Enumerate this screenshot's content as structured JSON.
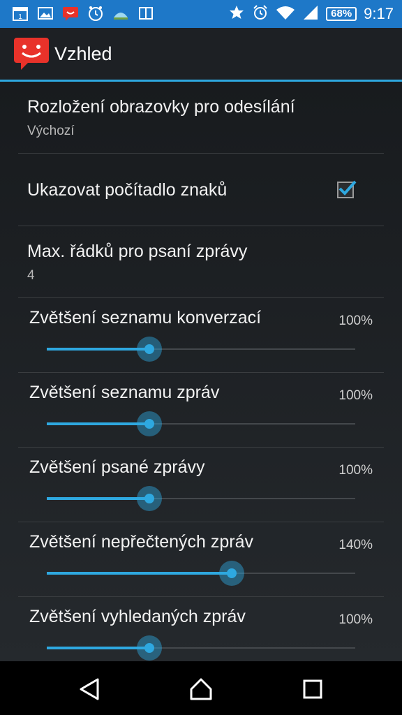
{
  "status_bar": {
    "battery_level": "68%",
    "time": "9:17",
    "icons": [
      "calendar-icon",
      "gallery-icon",
      "sms-notification-icon",
      "alarm-app-icon",
      "weather-icon",
      "book-icon",
      "star-icon",
      "alarm-clock-icon",
      "wifi-icon",
      "signal-icon",
      "battery-icon"
    ]
  },
  "action_bar": {
    "title": "Vzhled",
    "app_icon": "smiley-message-icon"
  },
  "preferences": [
    {
      "title": "Rozložení obrazovky pro odesílání",
      "summary": "Výchozí"
    },
    {
      "title": "Ukazovat počítadlo znaků",
      "checked": true
    },
    {
      "title": "Max. řádků pro psaní zprávy",
      "summary": "4"
    }
  ],
  "sliders": [
    {
      "title": "Zvětšení seznamu konverzací",
      "value": "100%",
      "level": 0.333
    },
    {
      "title": "Zvětšení seznamu zpráv",
      "value": "100%",
      "level": 0.333
    },
    {
      "title": "Zvětšení psané zprávy",
      "value": "100%",
      "level": 0.333
    },
    {
      "title": "Zvětšení nepřečtených zpráv",
      "value": "140%",
      "level": 0.6
    },
    {
      "title": "Zvětšení vyhledaných zpráv",
      "value": "100%",
      "level": 0.333
    }
  ],
  "nav_bar": {
    "buttons": [
      "back-icon",
      "home-icon",
      "recents-icon"
    ]
  },
  "colors": {
    "accent": "#2ea8e0",
    "status_bar": "#1e78c8",
    "app_icon": "#e8322a"
  }
}
